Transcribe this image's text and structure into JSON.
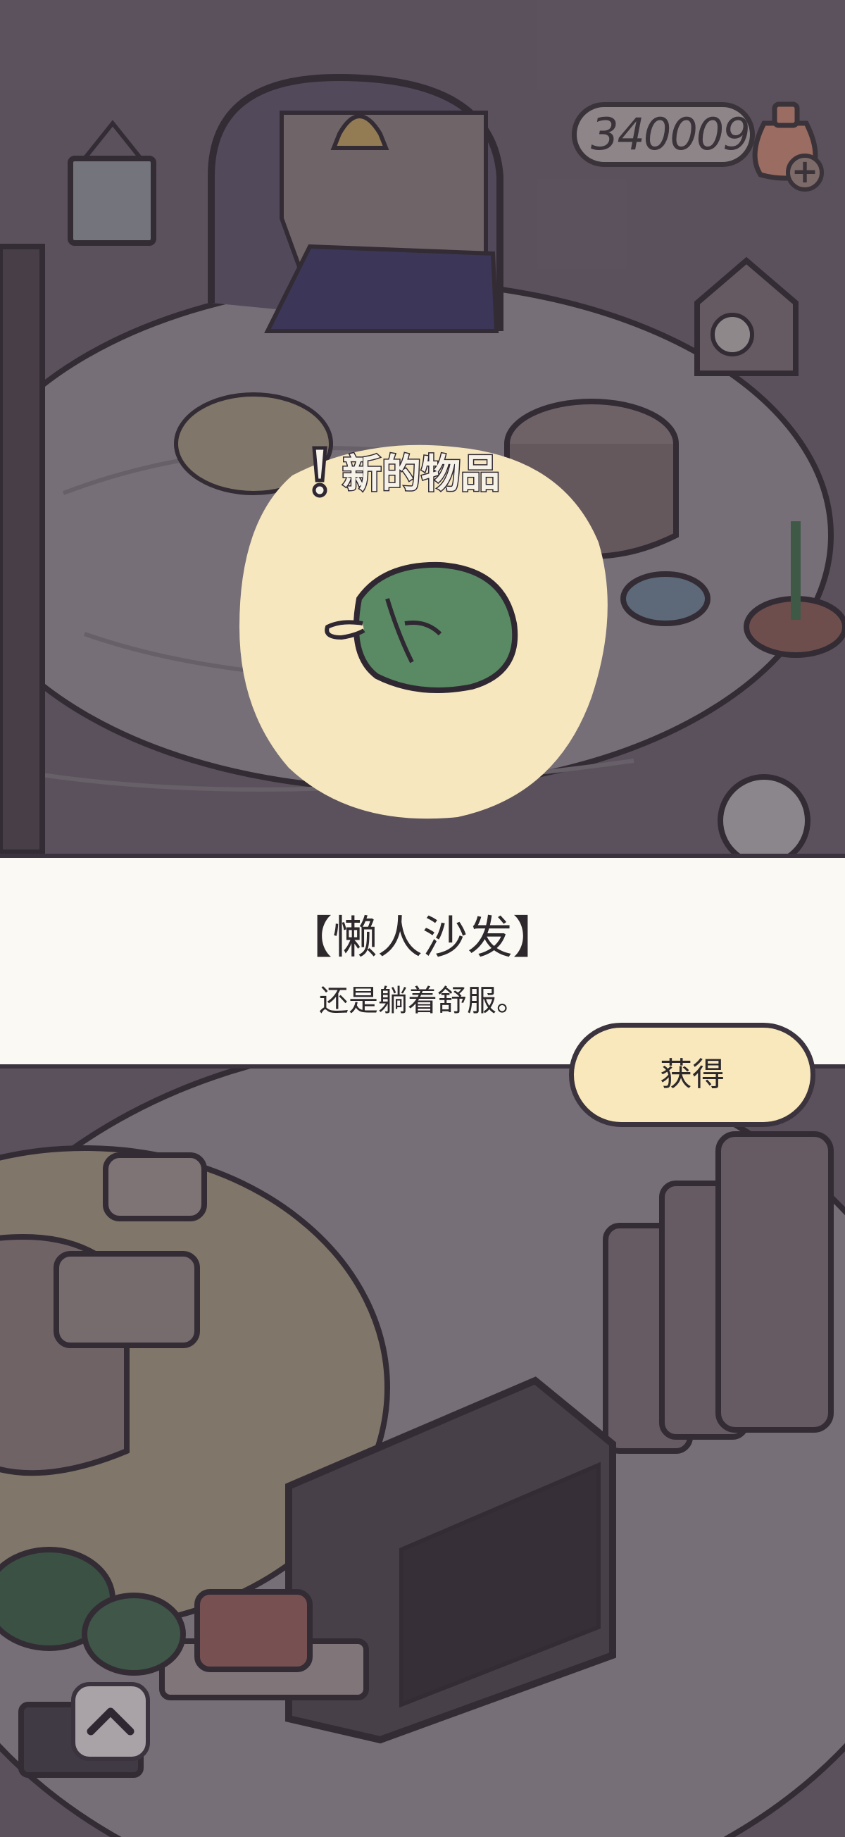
{
  "currency": {
    "amount": "340009",
    "icon": "coin-sack-icon",
    "add_icon": "plus-icon"
  },
  "new_item": {
    "label": "新的物品",
    "icon": "green-bean-bag-icon"
  },
  "item": {
    "name": "【懒人沙发】",
    "description": "还是躺着舒服。"
  },
  "actions": {
    "obtain_label": "获得",
    "expand_icon": "chevron-up-icon"
  },
  "colors": {
    "panel_bg": "#fbf9f4",
    "button_bg": "#f8e8bb",
    "highlight_bg": "#f6e7bf",
    "outline": "#3b333d"
  }
}
